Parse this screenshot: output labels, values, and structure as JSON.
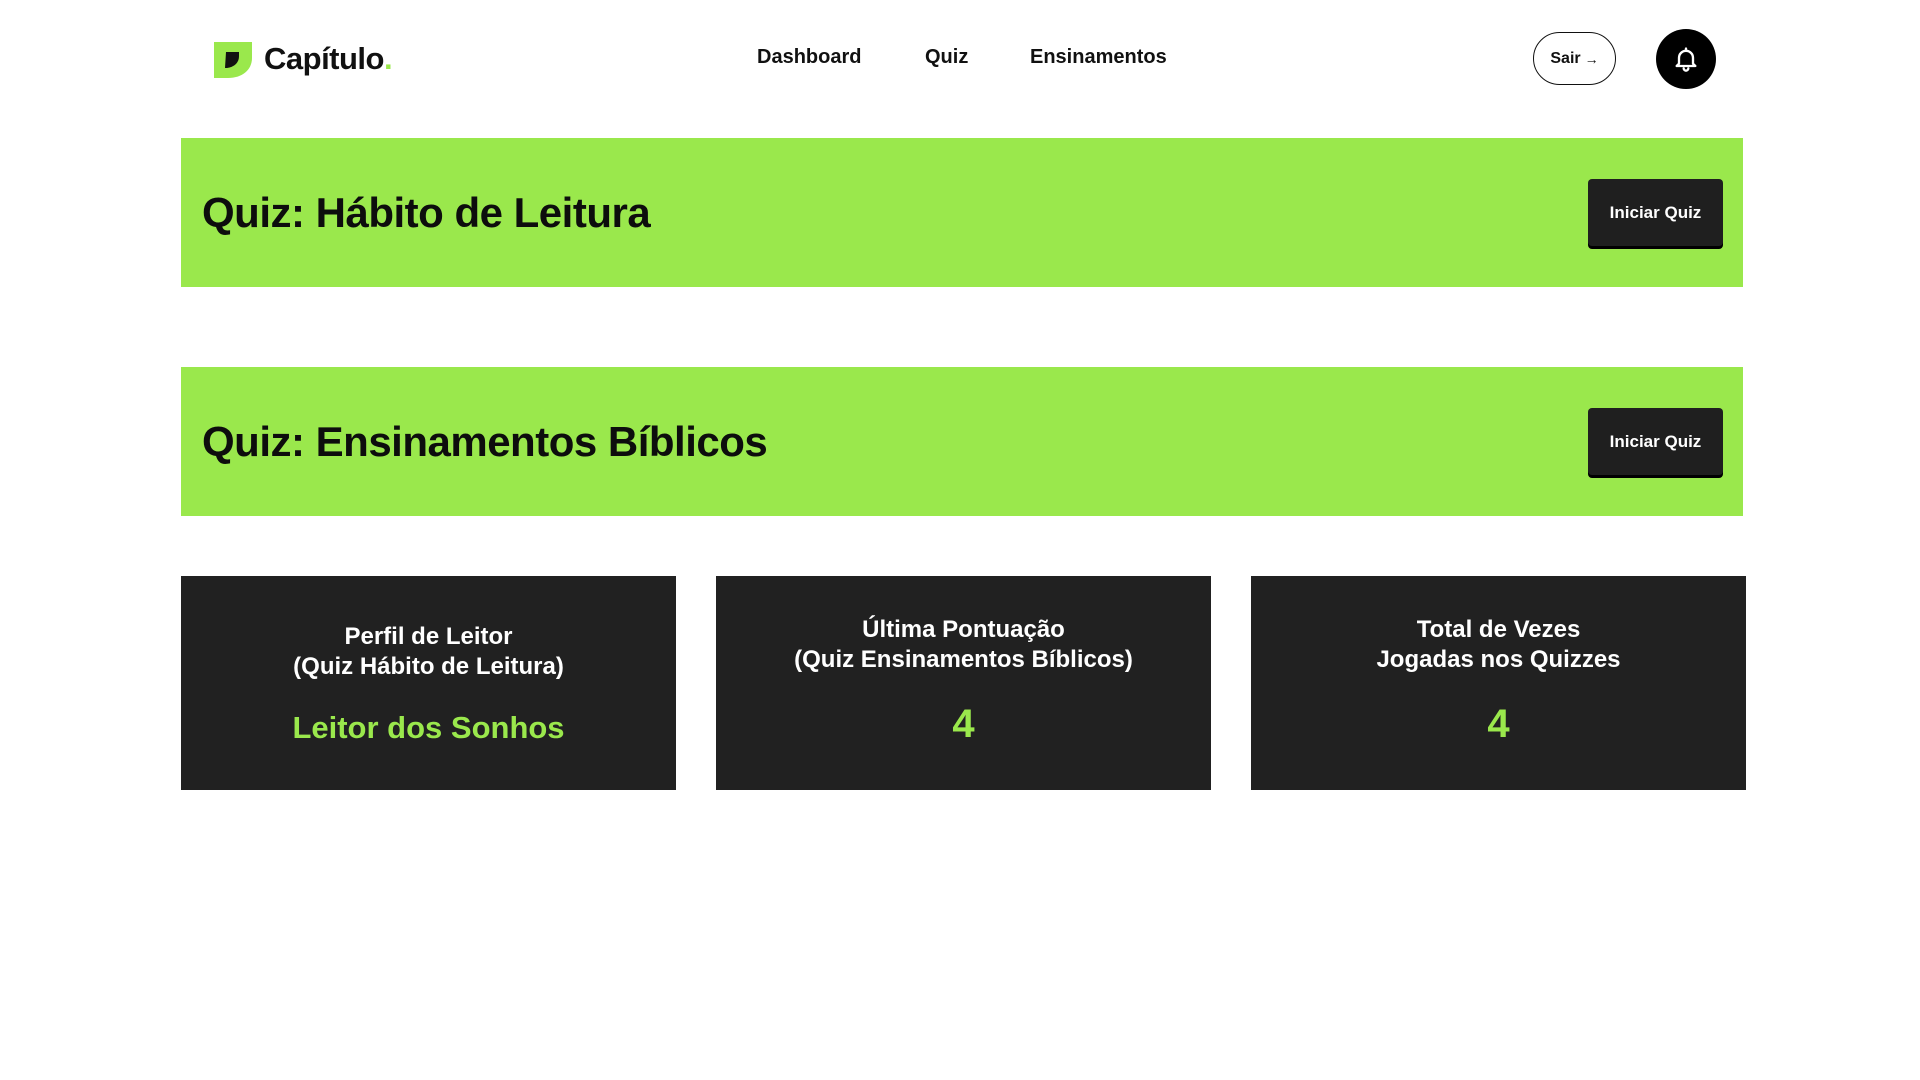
{
  "header": {
    "logo_text": "Capítulo",
    "logo_dot": ".",
    "logo_icon": "leaf-logo-icon",
    "nav": [
      "Dashboard",
      "Quiz",
      "Ensinamentos"
    ],
    "logout_label": "Sair",
    "logout_arrow": "→",
    "notification_icon": "bell-icon"
  },
  "quizzes": [
    {
      "title": "Quiz: Hábito de Leitura",
      "button_label": "Iniciar Quiz"
    },
    {
      "title": "Quiz: Ensinamentos Bíblicos",
      "button_label": "Iniciar Quiz"
    }
  ],
  "stats": [
    {
      "label_line1": "Perfil de Leitor",
      "label_line2": "(Quiz Hábito de Leitura)",
      "value": "Leitor dos Sonhos"
    },
    {
      "label_line1": "Última Pontuação",
      "label_line2": "(Quiz Ensinamentos Bíblicos)",
      "value": "4"
    },
    {
      "label_line1": "Total de Vezes",
      "label_line2": "Jogadas nos Quizzes",
      "value": "4"
    }
  ],
  "colors": {
    "accent": "#9ae84c",
    "dark": "#212121",
    "background": "#ffffff"
  }
}
